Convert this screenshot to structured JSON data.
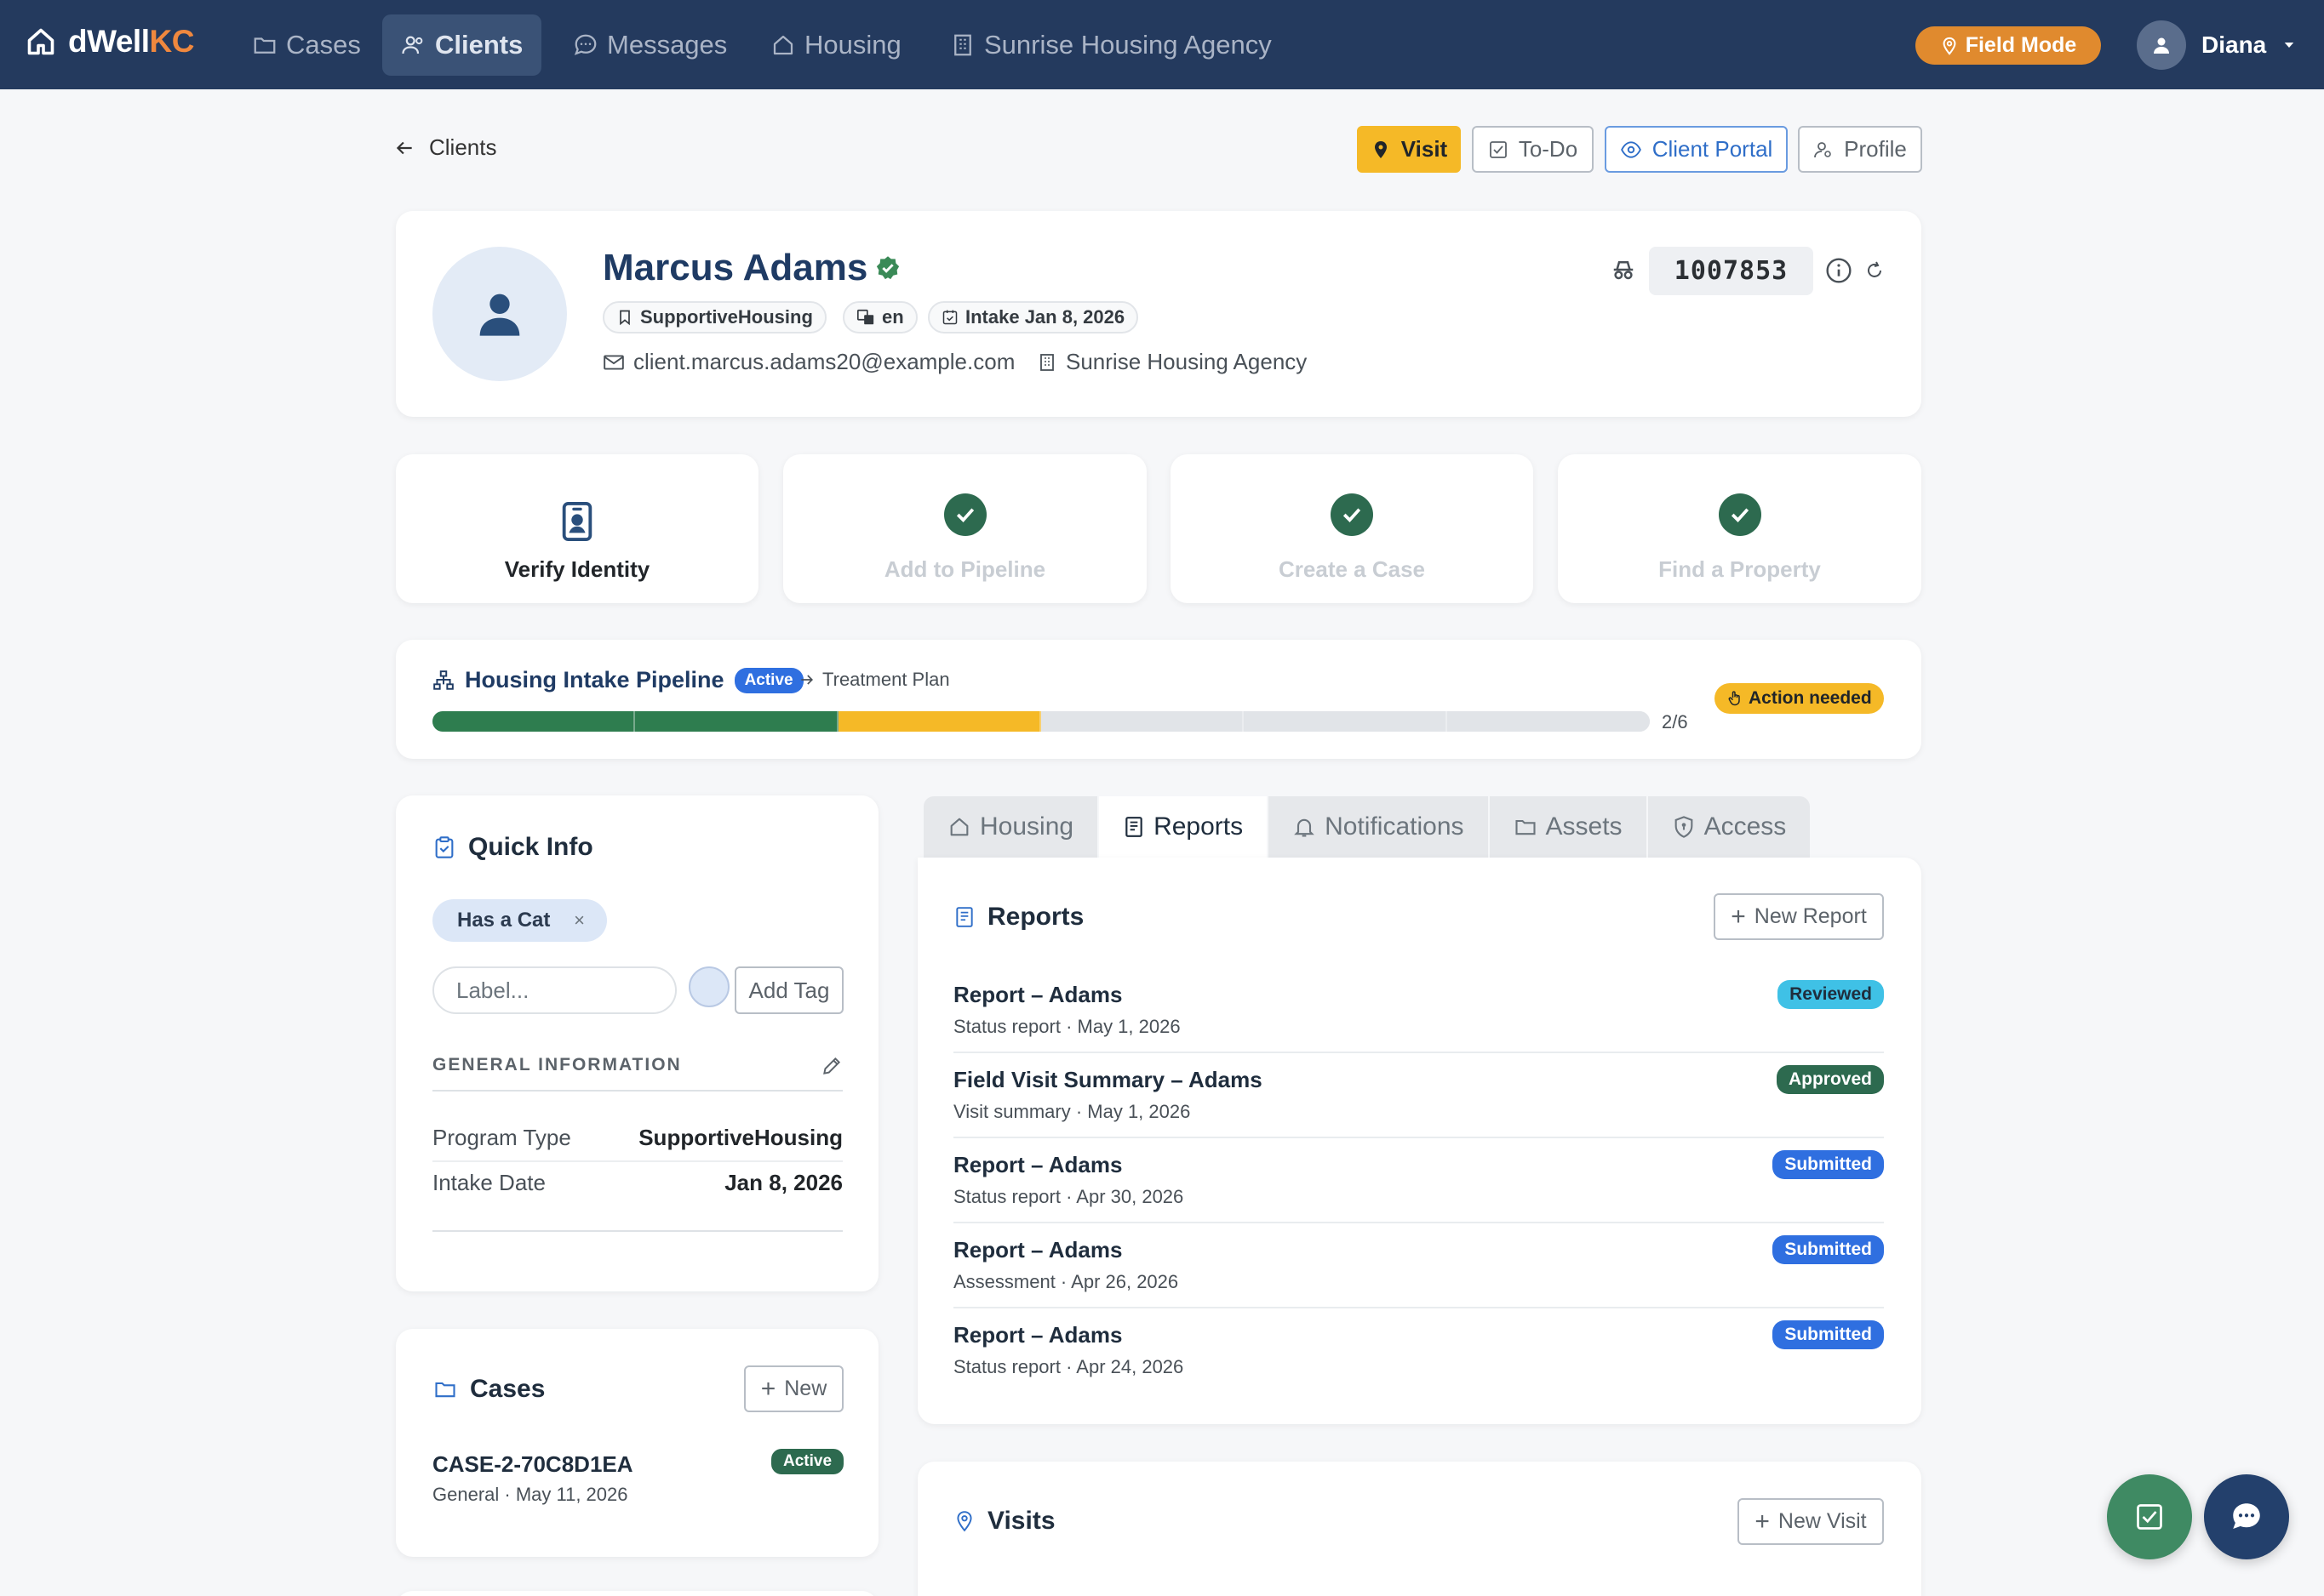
{
  "nav": {
    "brand_prefix": "dWell",
    "brand_suffix": "KC",
    "items": [
      {
        "label": "Cases",
        "icon": "folder-icon"
      },
      {
        "label": "Clients",
        "icon": "users-icon"
      },
      {
        "label": "Messages",
        "icon": "chat-icon"
      },
      {
        "label": "Housing",
        "icon": "house-icon"
      },
      {
        "label": "Sunrise Housing Agency",
        "icon": "building-icon"
      }
    ],
    "active": "Clients",
    "field_mode": "Field Mode",
    "user": "Diana"
  },
  "breadcrumb": {
    "back_label": "Clients"
  },
  "actions": {
    "visit": "Visit",
    "todo": "To-Do",
    "portal": "Client Portal",
    "profile": "Profile"
  },
  "client": {
    "name": "Marcus Adams",
    "program": "SupportiveHousing",
    "language": "en",
    "intake": "Intake Jan 8, 2026",
    "email": "client.marcus.adams20@example.com",
    "agency": "Sunrise Housing Agency",
    "id": "1007853"
  },
  "tiles": [
    {
      "label": "Verify Identity",
      "done": false
    },
    {
      "label": "Add to Pipeline",
      "done": true
    },
    {
      "label": "Create a Case",
      "done": true
    },
    {
      "label": "Find a Property",
      "done": true
    }
  ],
  "pipeline": {
    "title": "Housing Intake Pipeline",
    "status": "Active",
    "next_stage": "Treatment Plan",
    "count": "2/6",
    "alert": "Action needed",
    "colors": {
      "done": "#2e7d4f",
      "current": "#f5b927",
      "pending": "#e1e4e8"
    },
    "segments": [
      "done",
      "done",
      "current",
      "pending",
      "pending",
      "pending"
    ]
  },
  "quick_info": {
    "title": "Quick Info",
    "tag": "Has a Cat",
    "label_placeholder": "Label...",
    "add_tag": "Add Tag",
    "general_heading": "GENERAL INFORMATION",
    "rows": [
      {
        "label": "Program Type",
        "value": "SupportiveHousing"
      },
      {
        "label": "Intake Date",
        "value": "Jan 8, 2026"
      }
    ]
  },
  "cases": {
    "title": "Cases",
    "new_label": "New",
    "items": [
      {
        "code": "CASE-2-70C8D1EA",
        "sub": "General · May 11, 2026",
        "status": "Active"
      }
    ]
  },
  "tabs": [
    {
      "label": "Housing",
      "icon": "house-icon"
    },
    {
      "label": "Reports",
      "icon": "document-icon"
    },
    {
      "label": "Notifications",
      "icon": "bell-icon"
    },
    {
      "label": "Assets",
      "icon": "folder-icon"
    },
    {
      "label": "Access",
      "icon": "shield-icon"
    }
  ],
  "active_tab": "Reports",
  "reports": {
    "title": "Reports",
    "new_label": "New Report",
    "items": [
      {
        "title": "Report – Adams",
        "sub": "Status report · May 1, 2026",
        "status": "Reviewed"
      },
      {
        "title": "Field Visit Summary – Adams",
        "sub": "Visit summary · May 1, 2026",
        "status": "Approved"
      },
      {
        "title": "Report – Adams",
        "sub": "Status report · Apr 30, 2026",
        "status": "Submitted"
      },
      {
        "title": "Report – Adams",
        "sub": "Assessment · Apr 26, 2026",
        "status": "Submitted"
      },
      {
        "title": "Report – Adams",
        "sub": "Status report · Apr 24, 2026",
        "status": "Submitted"
      }
    ]
  },
  "visits": {
    "title": "Visits",
    "new_label": "New Visit"
  }
}
